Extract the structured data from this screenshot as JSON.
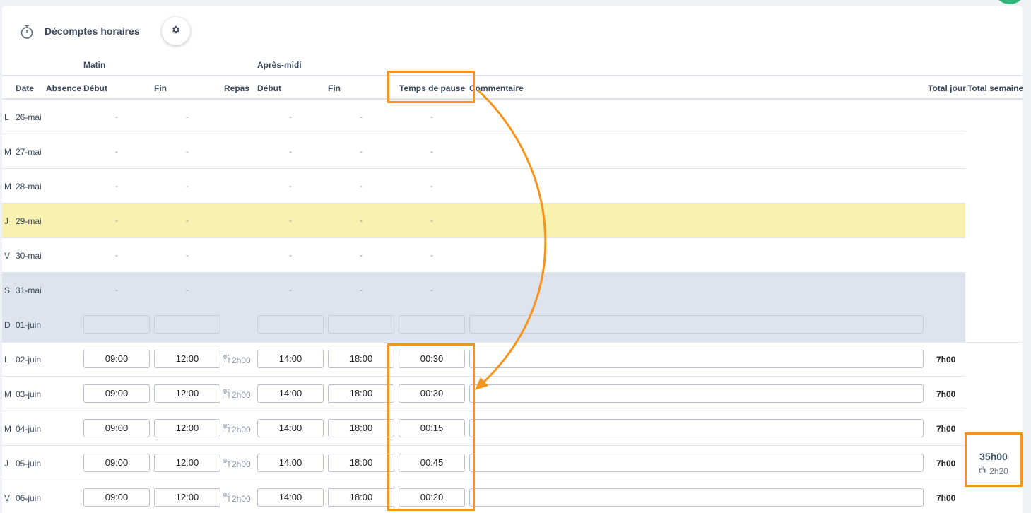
{
  "header": {
    "title": "Décomptes horaires",
    "icon": "stopwatch-icon",
    "settings_icon": "gear-icon"
  },
  "groups": {
    "morning": "Matin",
    "afternoon": "Après-midi"
  },
  "columns": {
    "date": "Date",
    "absence": "Absence",
    "morning_start": "Début",
    "morning_end": "Fin",
    "meal": "Repas",
    "afternoon_start": "Début",
    "afternoon_end": "Fin",
    "pause": "Temps de pause",
    "comment": "Commentaire",
    "day_total": "Total jour",
    "week_total": "Total semaine"
  },
  "past_rows": [
    {
      "day": "L",
      "date": "26-mai",
      "type": "normal",
      "m_start": "-",
      "m_end": "-",
      "a_start": "-",
      "a_end": "-",
      "pause": "-"
    },
    {
      "day": "M",
      "date": "27-mai",
      "type": "normal",
      "m_start": "-",
      "m_end": "-",
      "a_start": "-",
      "a_end": "-",
      "pause": "-"
    },
    {
      "day": "M",
      "date": "28-mai",
      "type": "normal",
      "m_start": "-",
      "m_end": "-",
      "a_start": "-",
      "a_end": "-",
      "pause": "-"
    },
    {
      "day": "J",
      "date": "29-mai",
      "type": "holiday",
      "m_start": "-",
      "m_end": "-",
      "a_start": "-",
      "a_end": "-",
      "pause": "-"
    },
    {
      "day": "V",
      "date": "30-mai",
      "type": "normal",
      "m_start": "-",
      "m_end": "-",
      "a_start": "-",
      "a_end": "-",
      "pause": "-"
    },
    {
      "day": "S",
      "date": "31-mai",
      "type": "weekend",
      "m_start": "-",
      "m_end": "-",
      "a_start": "-",
      "a_end": "-",
      "pause": "-"
    }
  ],
  "sunday_row": {
    "day": "D",
    "date": "01-juin"
  },
  "work_rows": [
    {
      "day": "L",
      "date": "02-juin",
      "m_start": "09:00",
      "m_end": "12:00",
      "meal": "2h00",
      "a_start": "14:00",
      "a_end": "18:00",
      "pause": "00:30",
      "comment": "",
      "total": "7h00"
    },
    {
      "day": "M",
      "date": "03-juin",
      "m_start": "09:00",
      "m_end": "12:00",
      "meal": "2h00",
      "a_start": "14:00",
      "a_end": "18:00",
      "pause": "00:30",
      "comment": "",
      "total": "7h00"
    },
    {
      "day": "M",
      "date": "04-juin",
      "m_start": "09:00",
      "m_end": "12:00",
      "meal": "2h00",
      "a_start": "14:00",
      "a_end": "18:00",
      "pause": "00:15",
      "comment": "",
      "total": "7h00"
    },
    {
      "day": "J",
      "date": "05-juin",
      "m_start": "09:00",
      "m_end": "12:00",
      "meal": "2h00",
      "a_start": "14:00",
      "a_end": "18:00",
      "pause": "00:45",
      "comment": "",
      "total": "7h00"
    },
    {
      "day": "V",
      "date": "06-juin",
      "m_start": "09:00",
      "m_end": "12:00",
      "meal": "2h00",
      "a_start": "14:00",
      "a_end": "18:00",
      "pause": "00:20",
      "comment": "",
      "total": "7h00"
    }
  ],
  "week_total": {
    "total": "35h00",
    "pause_total": "2h20",
    "pause_icon": "coffee-cup-icon"
  },
  "colors": {
    "annotation": "#f7941d",
    "holiday_row": "#f8f1b0",
    "weekend_row": "#dde4ee"
  }
}
